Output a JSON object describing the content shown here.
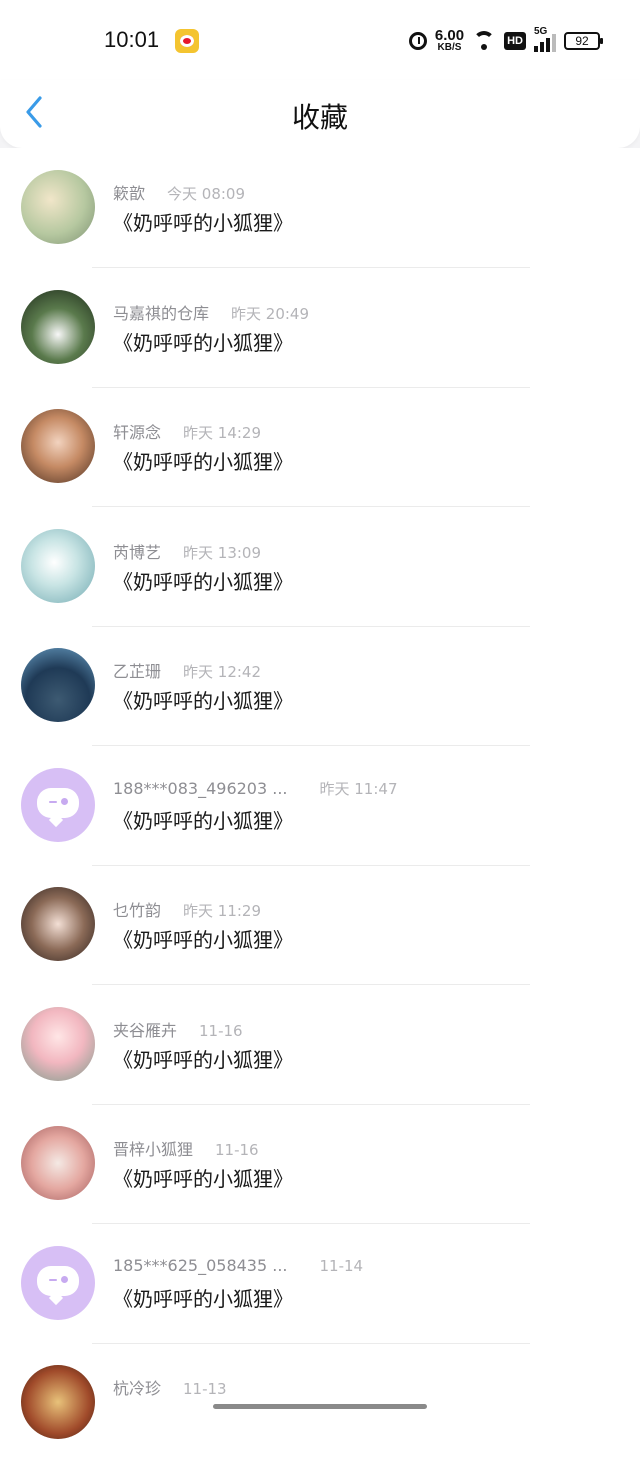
{
  "status_bar": {
    "time": "10:01",
    "net_speed_value": "6.00",
    "net_speed_unit": "KB/S",
    "hd_badge": "HD",
    "signal_label": "5G",
    "battery": "92"
  },
  "header": {
    "title": "收藏"
  },
  "items": [
    {
      "name": "簌歆",
      "time": "今天 08:09",
      "title": "《奶呼呼的小狐狸》",
      "avatar": "photo"
    },
    {
      "name": "马嘉祺的仓库",
      "time": "昨天 20:49",
      "title": "《奶呼呼的小狐狸》",
      "avatar": "photo"
    },
    {
      "name": "轩源念",
      "time": "昨天 14:29",
      "title": "《奶呼呼的小狐狸》",
      "avatar": "photo"
    },
    {
      "name": "芮博艺",
      "time": "昨天 13:09",
      "title": "《奶呼呼的小狐狸》",
      "avatar": "photo"
    },
    {
      "name": "乙芷珊",
      "time": "昨天 12:42",
      "title": "《奶呼呼的小狐狸》",
      "avatar": "photo"
    },
    {
      "name": "188***083_496203 ...",
      "time": "昨天 11:47",
      "title": "《奶呼呼的小狐狸》",
      "avatar": "default"
    },
    {
      "name": "乜竹韵",
      "time": "昨天 11:29",
      "title": "《奶呼呼的小狐狸》",
      "avatar": "photo"
    },
    {
      "name": "夹谷雁卉",
      "time": "11-16",
      "title": "《奶呼呼的小狐狸》",
      "avatar": "photo"
    },
    {
      "name": "晋梓小狐狸",
      "time": "11-16",
      "title": "《奶呼呼的小狐狸》",
      "avatar": "photo"
    },
    {
      "name": "185***625_058435 ...",
      "time": "11-14",
      "title": "《奶呼呼的小狐狸》",
      "avatar": "default"
    },
    {
      "name": "杭冷珍",
      "time": "11-13",
      "title": "",
      "avatar": "photo"
    }
  ],
  "colors": {
    "accent": "#3a9be8",
    "default_avatar_bg": "#d7bff5",
    "name_text": "#8e8e93",
    "time_text": "#b4b4b8",
    "title_text": "#1a1a1a"
  }
}
